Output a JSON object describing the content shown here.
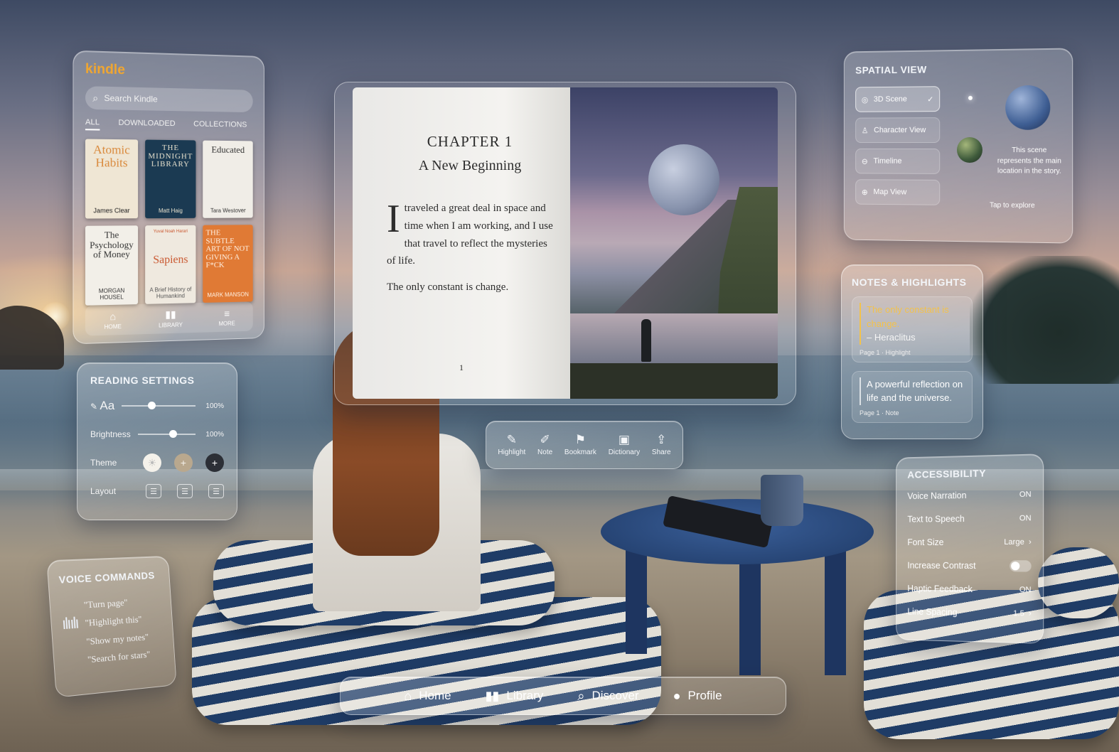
{
  "kindle": {
    "logo": "kindle",
    "search_placeholder": "Search Kindle",
    "tabs": [
      "ALL",
      "DOWNLOADED",
      "COLLECTIONS"
    ],
    "books": [
      {
        "title": "Atomic Habits",
        "author": "James Clear",
        "subtitle": ""
      },
      {
        "title": "THE MIDNIGHT LIBRARY",
        "author": "Matt Haig",
        "subtitle": ""
      },
      {
        "title": "Educated",
        "author": "Tara Westover",
        "subtitle": ""
      },
      {
        "title": "The Psychology of Money",
        "author": "MORGAN HOUSEL",
        "subtitle": ""
      },
      {
        "title": "Sapiens",
        "author": "Yuval Noah Harari",
        "subtitle": "A Brief History of Humankind"
      },
      {
        "title": "THE SUBTLE ART OF NOT GIVING A F*CK",
        "author": "MARK MANSON",
        "subtitle": ""
      }
    ],
    "nav": [
      {
        "label": "HOME",
        "icon": "home-icon"
      },
      {
        "label": "LIBRARY",
        "icon": "library-icon"
      },
      {
        "label": "MORE",
        "icon": "menu-icon"
      }
    ]
  },
  "reading_settings": {
    "title": "READING SETTINGS",
    "font_label": "Aa",
    "font_value": "100%",
    "font_level": 0.35,
    "brightness_label": "Brightness",
    "brightness_value": "100%",
    "brightness_level": 0.55,
    "theme_label": "Theme",
    "layout_label": "Layout"
  },
  "voice_commands": {
    "title": "VOICE COMMANDS",
    "commands": [
      "\"Turn page\"",
      "\"Highlight this\"",
      "\"Show my notes\"",
      "\"Search for stars\""
    ]
  },
  "book": {
    "chapter": "CHAPTER 1",
    "chapter_title": "A New Beginning",
    "dropcap": "I",
    "paragraph": "traveled a great deal in space and time when I am working, and I use that travel to reflect the mysteries of life.",
    "quote": "The only constant is change.",
    "page_number": "1"
  },
  "toolbar": {
    "items": [
      {
        "label": "Highlight",
        "icon": "pencil-icon"
      },
      {
        "label": "Note",
        "icon": "note-icon"
      },
      {
        "label": "Bookmark",
        "icon": "bookmark-icon"
      },
      {
        "label": "Dictionary",
        "icon": "dictionary-icon"
      },
      {
        "label": "Share",
        "icon": "share-icon"
      }
    ]
  },
  "spatial_view": {
    "title": "SPATIAL VIEW",
    "options": [
      {
        "label": "3D Scene",
        "icon": "cube-icon",
        "selected": true
      },
      {
        "label": "Character View",
        "icon": "person-icon",
        "selected": false
      },
      {
        "label": "Timeline",
        "icon": "timeline-icon",
        "selected": false
      },
      {
        "label": "Map View",
        "icon": "globe-icon",
        "selected": false
      }
    ],
    "description": "This scene represents the main location in the story.",
    "tap_hint": "Tap to explore"
  },
  "notes": {
    "title": "NOTES & HIGHLIGHTS",
    "items": [
      {
        "highlight": "The only constant is change.",
        "author": "– Heraclitus",
        "meta": "Page 1 · Highlight"
      },
      {
        "text": "A powerful reflection on life and the universe.",
        "meta": "Page 1 · Note"
      }
    ]
  },
  "accessibility": {
    "title": "ACCESSIBILITY",
    "rows": [
      {
        "label": "Voice Narration",
        "value": "ON"
      },
      {
        "label": "Text to Speech",
        "value": "ON"
      },
      {
        "label": "Font Size",
        "value": "Large"
      },
      {
        "label": "Increase Contrast",
        "value": ""
      },
      {
        "label": "Haptic Feedback",
        "value": "ON"
      },
      {
        "label": "Line Spacing",
        "value": "1.5"
      }
    ]
  },
  "bottom_nav": {
    "items": [
      {
        "label": "Home",
        "icon": "home-icon"
      },
      {
        "label": "Library",
        "icon": "library-icon"
      },
      {
        "label": "Discover",
        "icon": "search-icon"
      },
      {
        "label": "Profile",
        "icon": "profile-icon"
      }
    ]
  },
  "colors": {
    "kindle_accent": "#f0a630",
    "highlight": "#f3c24b"
  }
}
